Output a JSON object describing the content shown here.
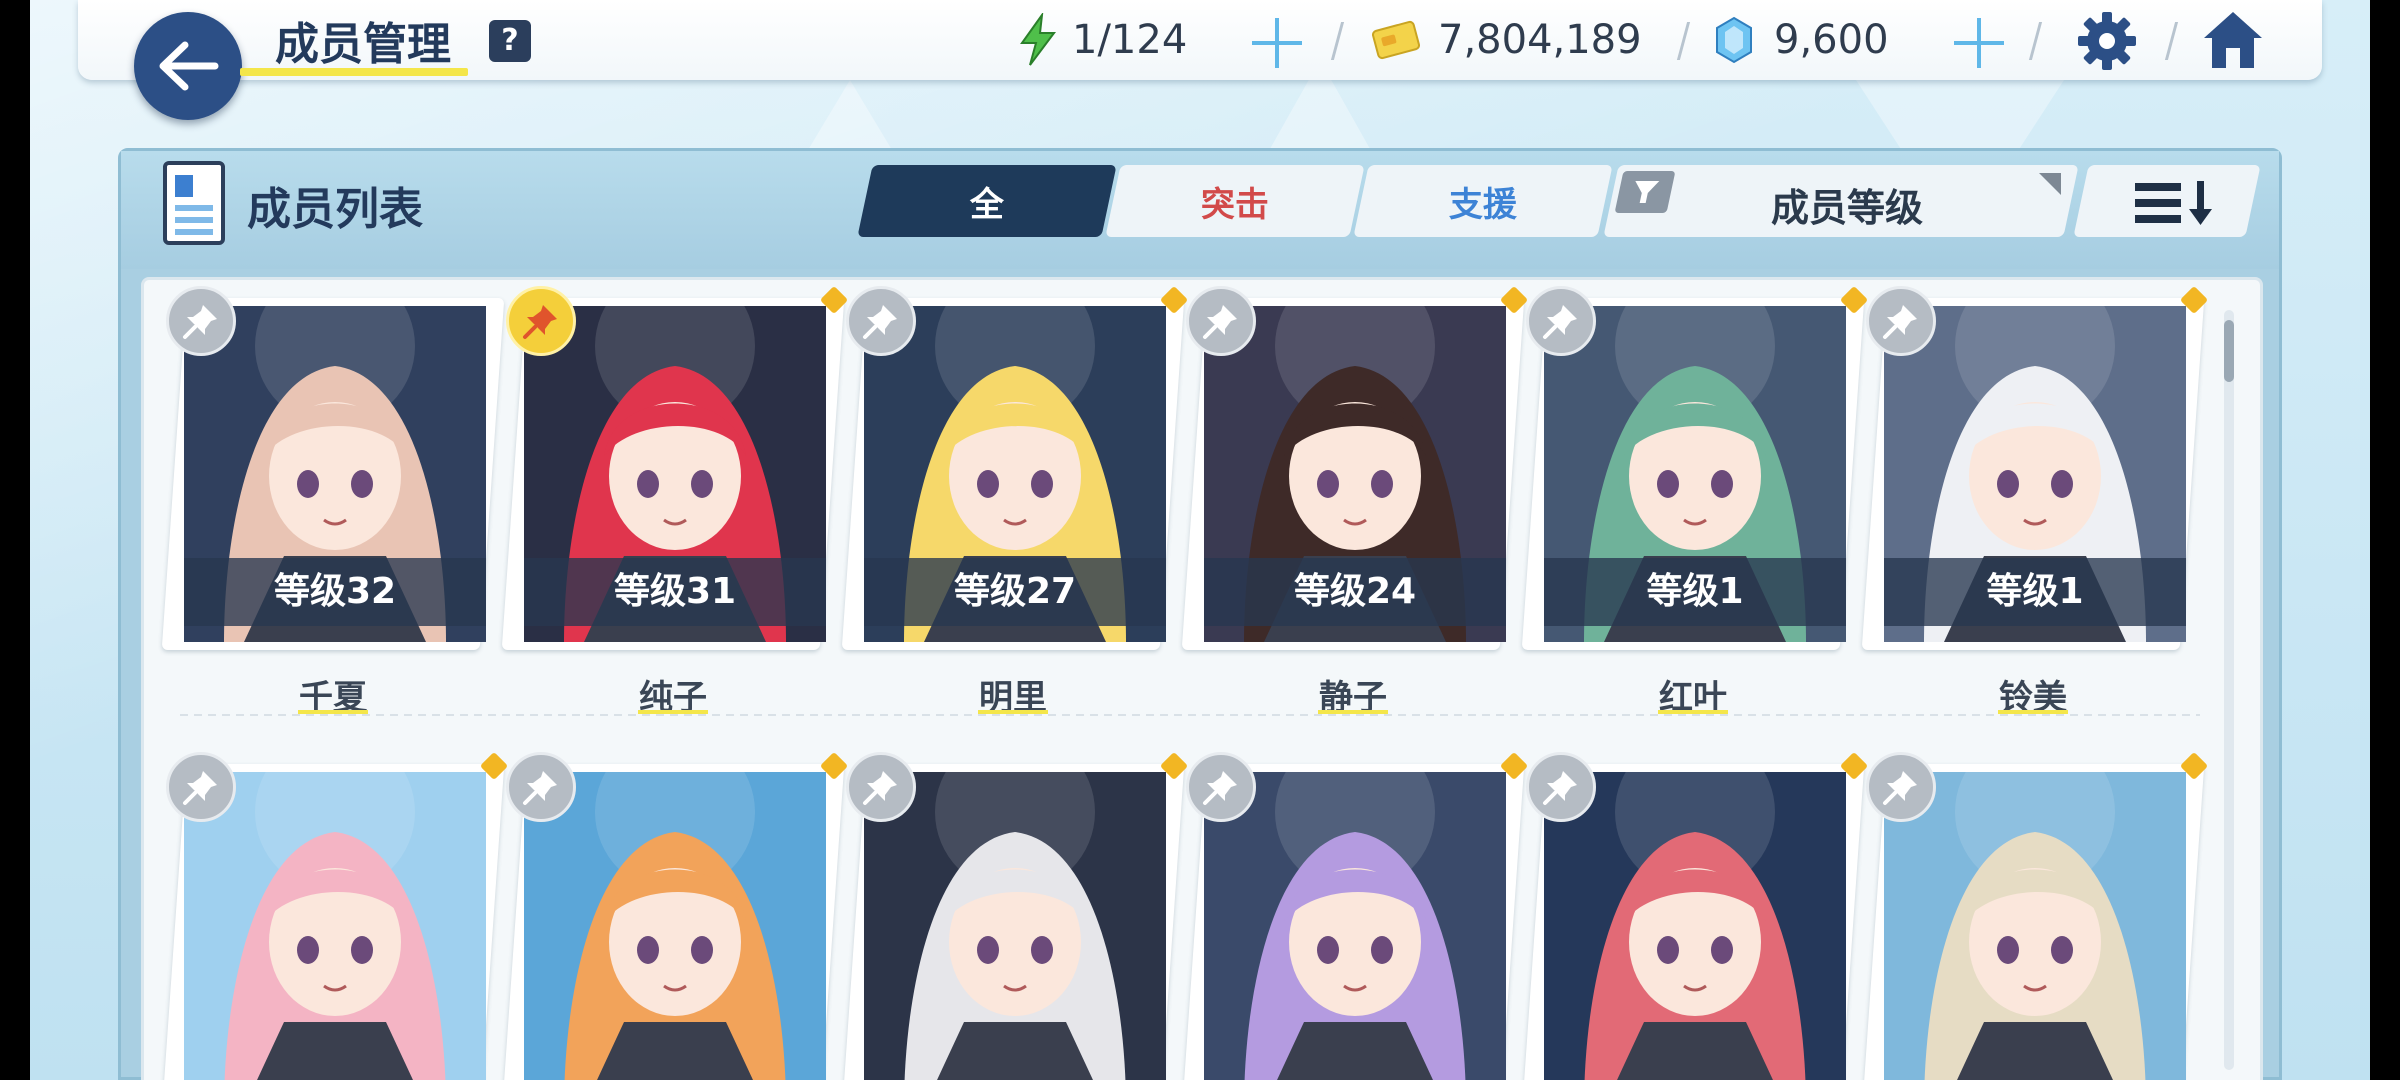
{
  "header": {
    "title": "成员管理",
    "help": "?",
    "ap": "1/124",
    "credits": "7,804,189",
    "gems": "9,600"
  },
  "panel": {
    "title": "成员列表",
    "tabs": [
      {
        "label": "全",
        "color": "#ffffff"
      },
      {
        "label": "突击",
        "color": "#d24a4a"
      },
      {
        "label": "支援",
        "color": "#3d83d6"
      }
    ],
    "sort_label": "成员等级"
  },
  "members": [
    {
      "level": "等级32",
      "name": "千夏",
      "pinned": false,
      "hair": "#e9c4b4",
      "bg": "#30405e"
    },
    {
      "level": "等级31",
      "name": "纯子",
      "pinned": true,
      "hair": "#e0354d",
      "bg": "#2a2f45"
    },
    {
      "level": "等级27",
      "name": "明里",
      "pinned": false,
      "hair": "#f6d86a",
      "bg": "#2c3e5a"
    },
    {
      "level": "等级24",
      "name": "静子",
      "pinned": false,
      "hair": "#3e2a28",
      "bg": "#3a3a52"
    },
    {
      "level": "等级1",
      "name": "红叶",
      "pinned": false,
      "hair": "#6fb29a",
      "bg": "#455873"
    },
    {
      "level": "等级1",
      "name": "铃美",
      "pinned": false,
      "hair": "#eef0f4",
      "bg": "#5e6e8a"
    },
    {
      "level": "",
      "name": "",
      "pinned": false,
      "hair": "#f4b4c4",
      "bg": "#9fd0ef"
    },
    {
      "level": "",
      "name": "",
      "pinned": false,
      "hair": "#f2a35a",
      "bg": "#5ba6d8"
    },
    {
      "level": "",
      "name": "",
      "pinned": false,
      "hair": "#e6e6ea",
      "bg": "#2c3448"
    },
    {
      "level": "",
      "name": "",
      "pinned": false,
      "hair": "#b49be0",
      "bg": "#3a4a6a"
    },
    {
      "level": "",
      "name": "",
      "pinned": false,
      "hair": "#e26a76",
      "bg": "#25385a"
    },
    {
      "level": "",
      "name": "",
      "pinned": false,
      "hair": "#e6dcc4",
      "bg": "#7fb8dc"
    }
  ]
}
